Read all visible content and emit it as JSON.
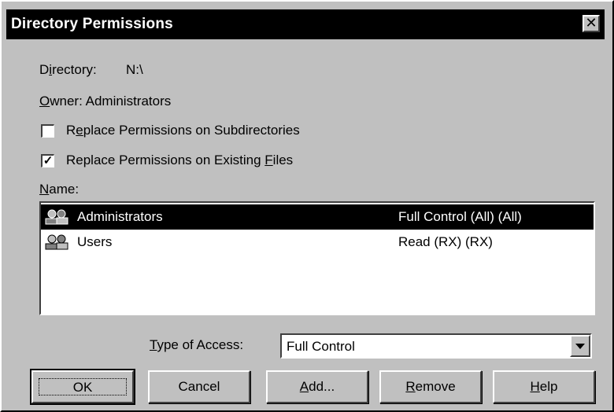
{
  "window": {
    "title": "Directory Permissions"
  },
  "directory": {
    "label_pre": "D",
    "label_mn": "i",
    "label_post": "rectory:",
    "value": "N:\\"
  },
  "owner": {
    "label_mn": "O",
    "label_post": "wner:",
    "value": "Administrators"
  },
  "checkboxes": [
    {
      "pre": "R",
      "mn": "e",
      "post": "place Permissions on Subdirectories",
      "checked": false,
      "mark": ""
    },
    {
      "pre": "Replace Permissions on Existing ",
      "mn": "F",
      "post": "iles",
      "checked": true,
      "mark": "✓"
    }
  ],
  "name_label": {
    "mn": "N",
    "post": "ame:"
  },
  "list": [
    {
      "name": "Administrators",
      "permission": "Full Control (All) (All)",
      "selected": true,
      "icon": "group-icon"
    },
    {
      "name": "Users",
      "permission": "Read (RX) (RX)",
      "selected": false,
      "icon": "group-icon"
    }
  ],
  "type_of_access": {
    "label_mn": "T",
    "label_post": "ype of Access:",
    "value": "Full Control"
  },
  "buttons": {
    "ok": {
      "label": "OK"
    },
    "cancel": {
      "label": "Cancel"
    },
    "add": {
      "mn": "A",
      "post": "dd..."
    },
    "remove": {
      "mn": "R",
      "post": "emove"
    },
    "help": {
      "mn": "H",
      "post": "elp"
    }
  },
  "colors": {
    "face": "#c0c0c0",
    "selection": "#000000",
    "window": "#ffffff"
  }
}
